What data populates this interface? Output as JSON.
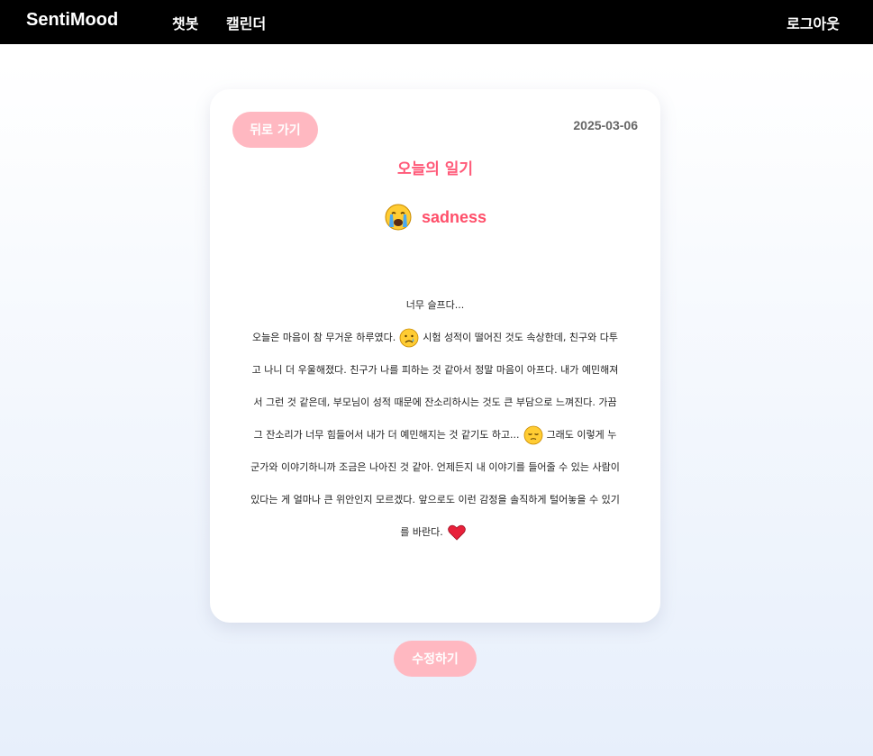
{
  "nav": {
    "brand": "SentiMood",
    "chatbot": "챗봇",
    "calendar": "캘린더",
    "logout": "로그아웃"
  },
  "diary": {
    "back_label": "뒤로 가기",
    "date": "2025-03-06",
    "title": "오늘의 일기",
    "emotion_icon": "crying-face-icon",
    "emotion": "sadness",
    "content": {
      "line1": "너무 슬프다...",
      "p1": "오늘은 마음이 참 무거운 하루였다.",
      "p2": "시험 성적이 떨어진 것도 속상한데, 친구와 다투고 나니 더 우울해졌다. 친구가 나를 피하는 것 같아서 정말 마음이 아프다. 내가 예민해져서 그런 것 같은데, 부모님이 성적 때문에 잔소리하시는 것도 큰 부담으로 느껴진다. 가끔 그 잔소리가 너무 힘들어서 내가 더 예민해지는 것 같기도 하고...",
      "p3": "그래도 이렇게 누군가와 이야기하니까 조금은 나아진 것 같아. 언제든지 내 이야기를 들어줄 수 있는 사람이 있다는 게 얼마나 큰 위안인지 모르겠다. 앞으로도 이런 감정을 솔직하게 털어놓을 수 있기를 바란다."
    },
    "inline_icons": [
      "sad-face-icon",
      "pensive-face-icon",
      "heart-icon"
    ],
    "edit_label": "수정하기"
  },
  "colors": {
    "accent": "#ff5a79",
    "button": "#ffb8c1",
    "navbar": "#000000"
  }
}
